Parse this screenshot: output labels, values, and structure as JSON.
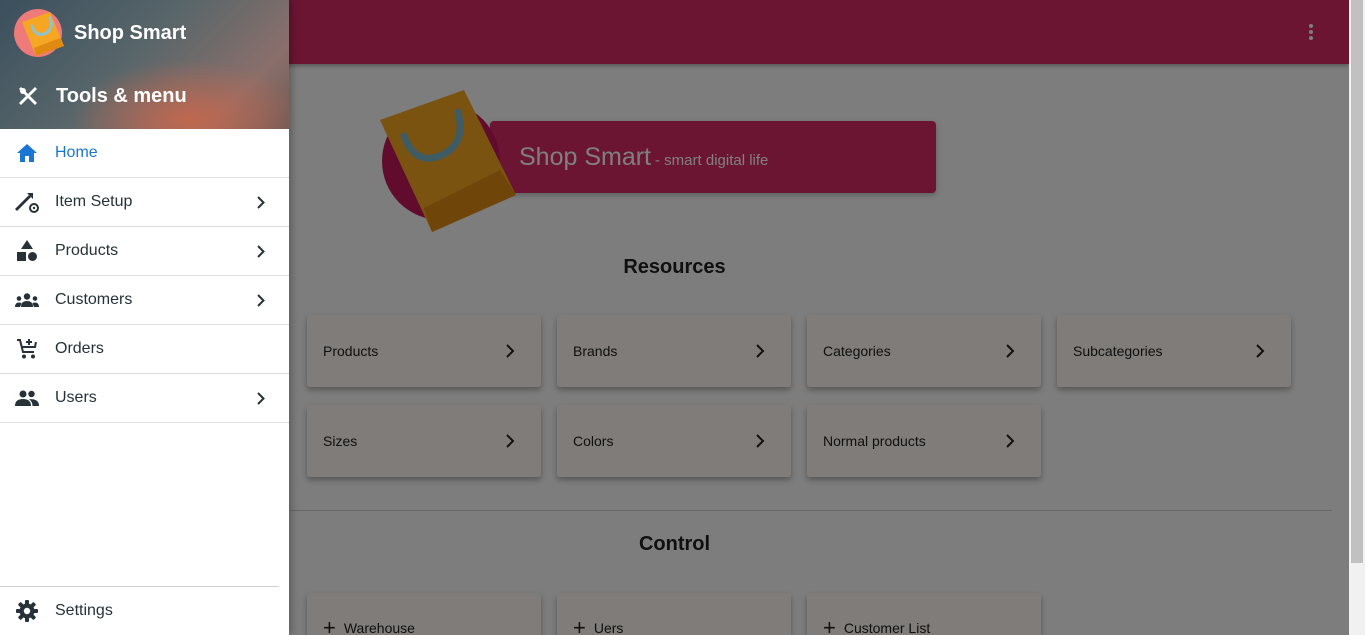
{
  "app": {
    "brand_name": "Shop Smart",
    "tools_label": "Tools & menu"
  },
  "nav": [
    {
      "label": "Home",
      "icon": "home-icon",
      "active": true,
      "has_submenu": false
    },
    {
      "label": "Item Setup",
      "icon": "item-setup-icon",
      "active": false,
      "has_submenu": true
    },
    {
      "label": "Products",
      "icon": "shapes-icon",
      "active": false,
      "has_submenu": true
    },
    {
      "label": "Customers",
      "icon": "groups-icon",
      "active": false,
      "has_submenu": true
    },
    {
      "label": "Orders",
      "icon": "cart-icon",
      "active": false,
      "has_submenu": false
    },
    {
      "label": "Users",
      "icon": "people-icon",
      "active": false,
      "has_submenu": true
    }
  ],
  "settings_label": "Settings",
  "hero": {
    "title": "Shop Smart",
    "subtitle": "- smart digital life"
  },
  "resources": {
    "title": "Resources",
    "tiles": [
      "Products",
      "Brands",
      "Categories",
      "Subcategories",
      "Sizes",
      "Colors",
      "Normal products"
    ]
  },
  "control": {
    "title": "Control",
    "tiles": [
      "Warehouse",
      "Uers",
      "Customer List"
    ]
  },
  "colors": {
    "primary": "#d62a67",
    "active_nav": "#1976d2",
    "bag": "#f5a623"
  }
}
